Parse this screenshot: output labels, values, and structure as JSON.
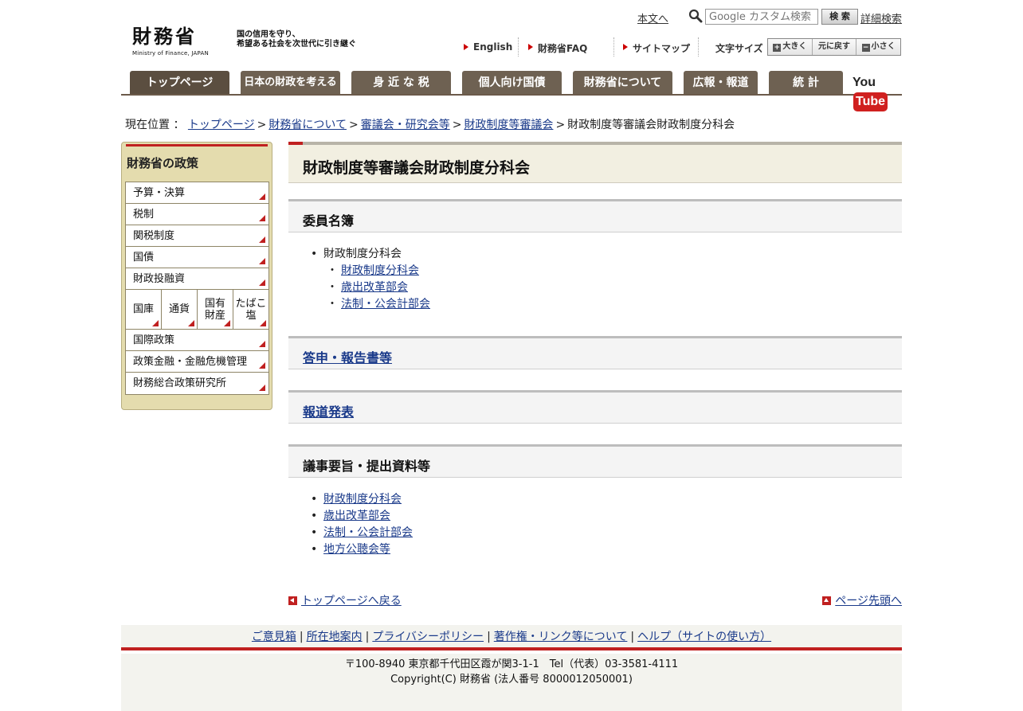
{
  "header": {
    "logo_main": "財務省",
    "logo_sub": "Ministry of Finance, JAPAN",
    "tagline_line1": "国の信用を守り、",
    "tagline_line2": "希望ある社会を次世代に引き継ぐ",
    "skip_link": "本文へ",
    "search_placeholder": "Google カスタム検索",
    "search_button": "検 索",
    "advanced_search": "詳細検索",
    "util_links": [
      "English",
      "財務省FAQ",
      "サイトマップ"
    ],
    "fontsize_label": "文字サイズ",
    "fontsize_buttons": [
      "大きく",
      "元に戻す",
      "小さく"
    ]
  },
  "gnav": {
    "tabs": [
      "トップページ",
      "日本の財政を考える",
      "身 近 な 税",
      "個人向け国債",
      "財務省について",
      "広報・報道",
      "統 計"
    ],
    "youtube_you": "You",
    "youtube_tube": "Tube"
  },
  "breadcrumb": {
    "prefix": "現在位置 ：",
    "items": [
      "トップページ",
      "財務省について",
      "審議会・研究会等",
      "財政制度等審議会"
    ],
    "current": "財政制度等審議会財政制度分科会"
  },
  "sidebar": {
    "title": "財務省の政策",
    "items_top": [
      "予算・決算",
      "税制",
      "関税制度",
      "国債",
      "財政投融資"
    ],
    "grid": [
      [
        "国庫",
        ""
      ],
      [
        "通貨",
        ""
      ],
      [
        "国有",
        "財産"
      ],
      [
        "たばこ",
        "塩"
      ]
    ],
    "items_bottom": [
      "国際政策",
      "政策金融・金融危機管理",
      "財務総合政策研究所"
    ]
  },
  "main": {
    "page_title": "財政制度等審議会財政制度分科会",
    "sections": {
      "members": {
        "title": "委員名簿",
        "group": "財政制度分科会",
        "links": [
          "財政制度分科会",
          "歳出改革部会",
          "法制・公会計部会"
        ]
      },
      "reports": {
        "title": "答申・報告書等"
      },
      "press": {
        "title": "報道発表"
      },
      "minutes": {
        "title": "議事要旨・提出資料等",
        "links": [
          "財政制度分科会",
          "歳出改革部会",
          "法制・公会計部会",
          "地方公聴会等"
        ]
      }
    },
    "back_to_top_page": "トップページへ戻る",
    "page_top": "ページ先頭へ"
  },
  "footer": {
    "links": [
      "ご意見箱",
      "所在地案内",
      "プライバシーポリシー",
      "著作権・リンク等について",
      "ヘルプ（サイトの使い方）"
    ],
    "address": "〒100-8940 東京都千代田区霞が関3-1-1　Tel（代表）03-3581-4111",
    "copyright": "Copyright(C) 財務省 (法人番号 8000012050001)"
  },
  "colors": {
    "accent_red": "#c02020",
    "nav_brown": "#6e6152",
    "sidebar_bg": "#e4dcae",
    "link_blue": "#1a3a8a"
  }
}
